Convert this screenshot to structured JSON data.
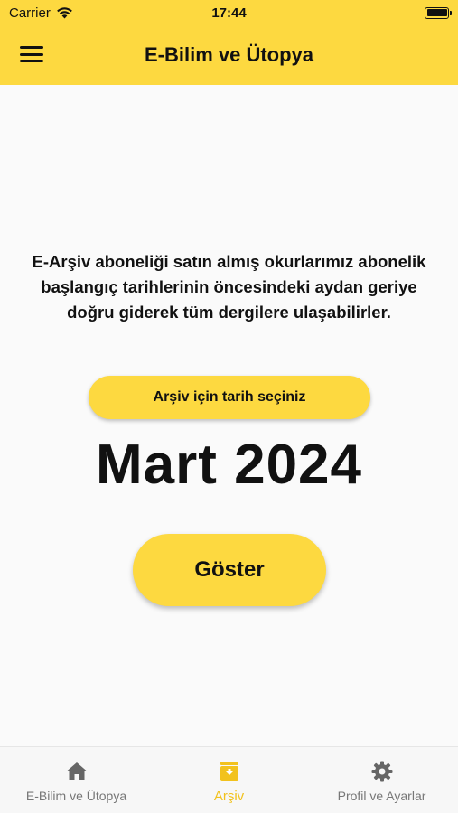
{
  "status_bar": {
    "carrier": "Carrier",
    "time": "17:44"
  },
  "header": {
    "title": "E-Bilim ve Ütopya"
  },
  "main": {
    "description": "E-Arşiv aboneliği satın almış okurlarımız abonelik başlangıç tarihlerinin öncesindeki aydan geriye doğru giderek tüm dergilere ulaşabilirler.",
    "date_button_label": "Arşiv için tarih seçiniz",
    "selected_date": "Mart 2024",
    "show_button_label": "Göster"
  },
  "tabs": [
    {
      "label": "E-Bilim ve Ütopya",
      "icon": "home-icon",
      "active": false
    },
    {
      "label": "Arşiv",
      "icon": "archive-icon",
      "active": true
    },
    {
      "label": "Profil ve Ayarlar",
      "icon": "gear-icon",
      "active": false
    }
  ],
  "colors": {
    "accent": "#fdd940",
    "active_tab": "#f2c21d",
    "inactive_tab": "#777777"
  }
}
